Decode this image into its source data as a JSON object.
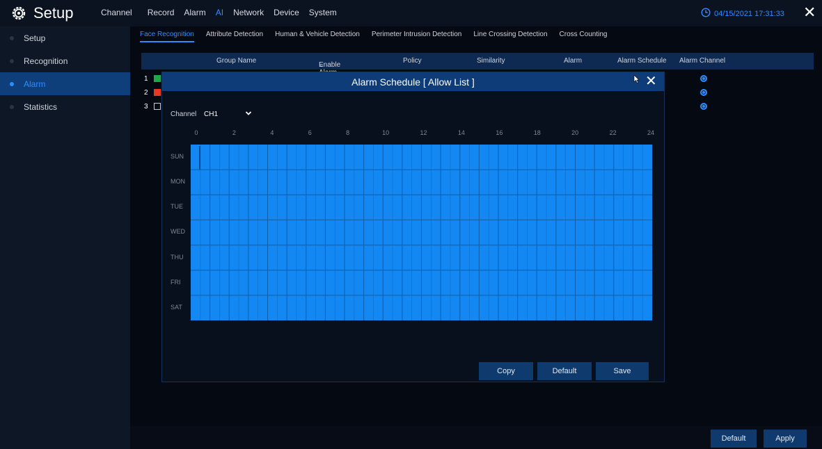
{
  "app": {
    "title": "Setup",
    "gear_icon": "gear-icon"
  },
  "topnav": [
    "Channel",
    "Record",
    "Alarm",
    "AI",
    "Network",
    "Device",
    "System"
  ],
  "topnav_active": "AI",
  "clock": {
    "icon": "clock-icon",
    "text": "04/15/2021 17:31:33"
  },
  "sidebar": {
    "items": [
      {
        "label": "Setup"
      },
      {
        "label": "Recognition"
      },
      {
        "label": "Alarm",
        "active": true
      },
      {
        "label": "Statistics"
      }
    ]
  },
  "subtabs": [
    "Face Recognition",
    "Attribute Detection",
    "Human & Vehicle Detection",
    "Perimeter Intrusion Detection",
    "Line Crossing Detection",
    "Cross Counting"
  ],
  "table": {
    "headers": {
      "group_name": "Group Name",
      "enable_alarm": "Enable Alarm",
      "policy": "Policy",
      "similarity": "Similarity",
      "alarm": "Alarm",
      "alarm_schedule": "Alarm Schedule",
      "alarm_channel": "Alarm Channel"
    },
    "rows": [
      {
        "num": "1",
        "color": "#1fa84a"
      },
      {
        "num": "2",
        "color": "#e8391f"
      },
      {
        "num": "3",
        "color": "#0a0f1a"
      }
    ]
  },
  "footer": {
    "default_label": "Default",
    "apply_label": "Apply"
  },
  "modal": {
    "title": "Alarm Schedule [ Allow List ]",
    "channel_label": "Channel",
    "channel_value": "CH1",
    "hours": [
      "0",
      "2",
      "4",
      "6",
      "8",
      "10",
      "12",
      "14",
      "16",
      "18",
      "20",
      "22",
      "24"
    ],
    "days": [
      "SUN",
      "MON",
      "TUE",
      "WED",
      "THU",
      "FRI",
      "SAT"
    ],
    "schedule_color": "#1387f2",
    "schedule_coverage": 1.0,
    "copy_label": "Copy",
    "default_label": "Default",
    "save_label": "Save"
  }
}
